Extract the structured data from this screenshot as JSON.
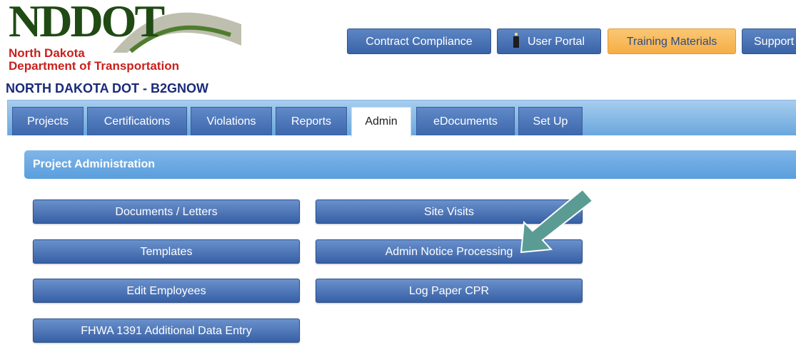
{
  "header": {
    "logo_abbr": "NDDOT",
    "logo_line1": "North Dakota",
    "logo_line2": "Department of Transportation",
    "site_title": "NORTH DAKOTA DOT - B2GNOW"
  },
  "top_nav": {
    "contract_compliance": "Contract Compliance",
    "user_portal": "User Portal",
    "training_materials": "Training Materials",
    "support": "Support"
  },
  "tabs": [
    {
      "label": "Projects"
    },
    {
      "label": "Certifications"
    },
    {
      "label": "Violations"
    },
    {
      "label": "Reports"
    },
    {
      "label": "Admin"
    },
    {
      "label": "eDocuments"
    },
    {
      "label": "Set Up"
    }
  ],
  "section": {
    "title": "Project Administration"
  },
  "admin_buttons": {
    "documents_letters": "Documents / Letters",
    "site_visits": "Site Visits",
    "templates": "Templates",
    "admin_notice_processing": "Admin Notice Processing",
    "edit_employees": "Edit Employees",
    "log_paper_cpr": "Log Paper CPR",
    "fhwa_1391": "FHWA 1391 Additional Data Entry"
  },
  "colors": {
    "brand_green": "#1f4a14",
    "brand_red": "#c8201c",
    "nav_blue": "#3a64a8",
    "training_orange": "#f5ae45",
    "arrow_teal": "#5a9c93"
  },
  "icons": {
    "user_portal": "lighthouse-icon",
    "annotation": "pointer-arrow-icon"
  }
}
